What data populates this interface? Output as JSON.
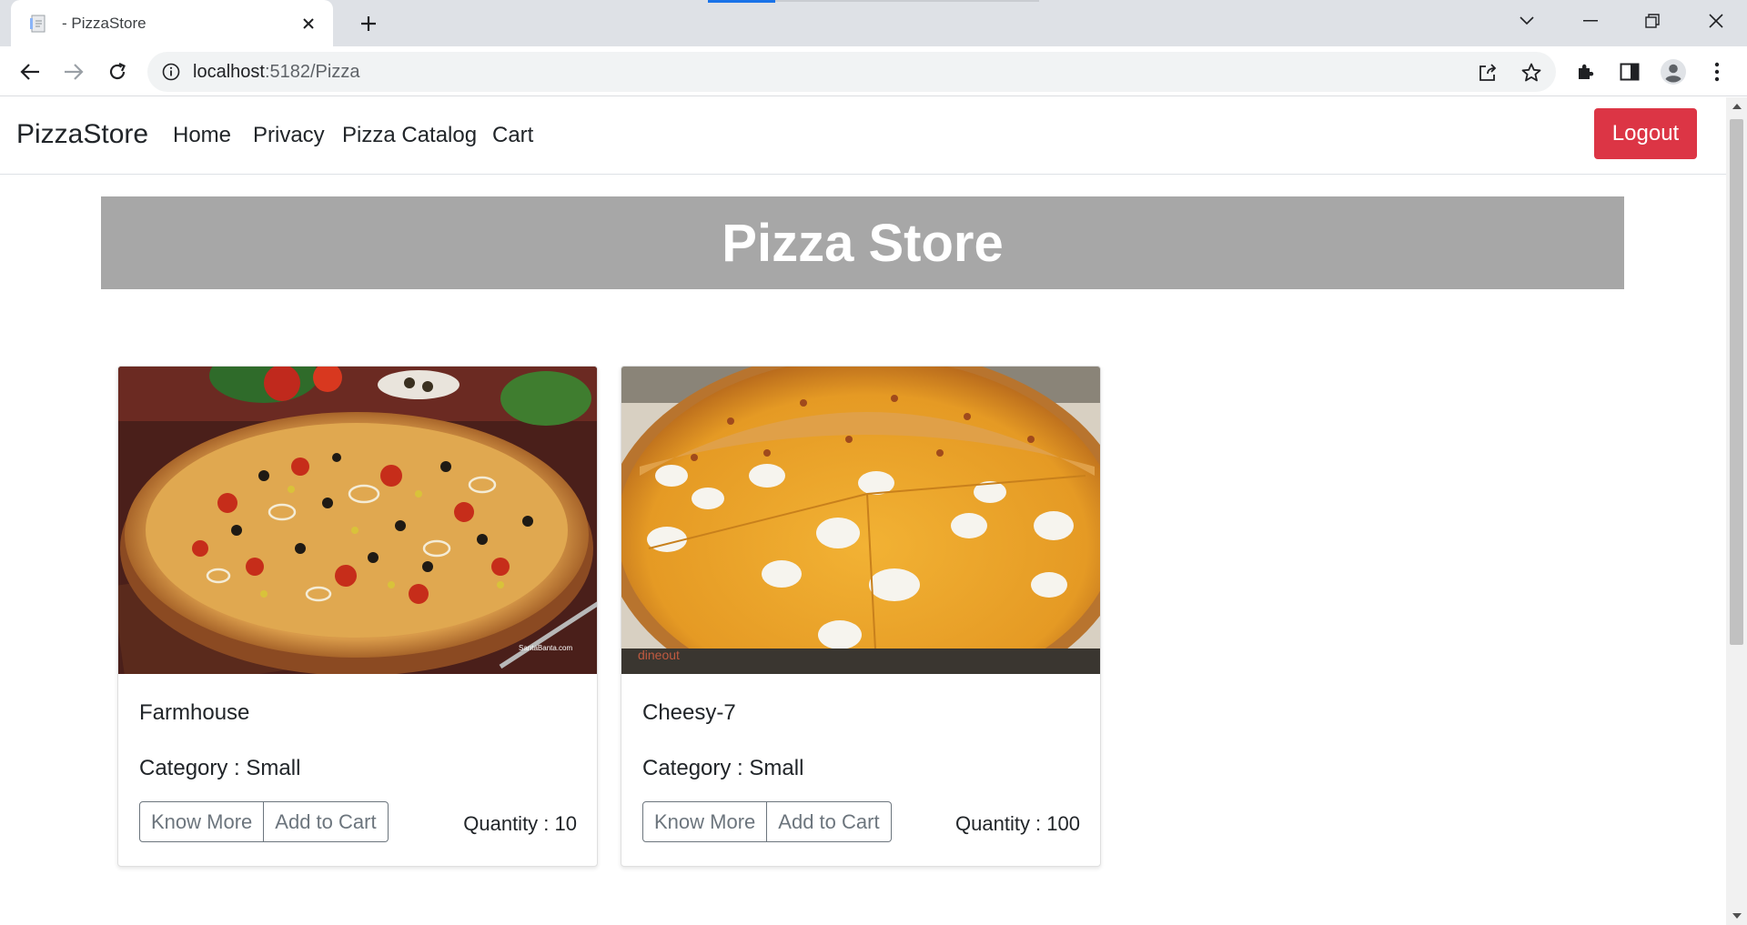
{
  "browser": {
    "tab_title": "- PizzaStore",
    "url_host": "localhost",
    "url_path": ":5182/Pizza",
    "accent_color": "#1a73e8"
  },
  "navbar": {
    "brand": "PizzaStore",
    "links": [
      "Home",
      "Privacy",
      "Pizza Catalog",
      "Cart"
    ],
    "logout_label": "Logout",
    "logout_color": "#dc3545"
  },
  "banner": {
    "title": "Pizza Store",
    "background": "#a7a7a7"
  },
  "pizzas": [
    {
      "name": "Farmhouse",
      "category_text": "Category : Small",
      "know_more_label": "Know More",
      "add_to_cart_label": "Add to Cart",
      "quantity_text": "Quantity : 10",
      "image_watermark": "SantaBanta.com"
    },
    {
      "name": "Cheesy-7",
      "category_text": "Category : Small",
      "know_more_label": "Know More",
      "add_to_cart_label": "Add to Cart",
      "quantity_text": "Quantity : 100",
      "image_watermark": "dineout"
    }
  ]
}
